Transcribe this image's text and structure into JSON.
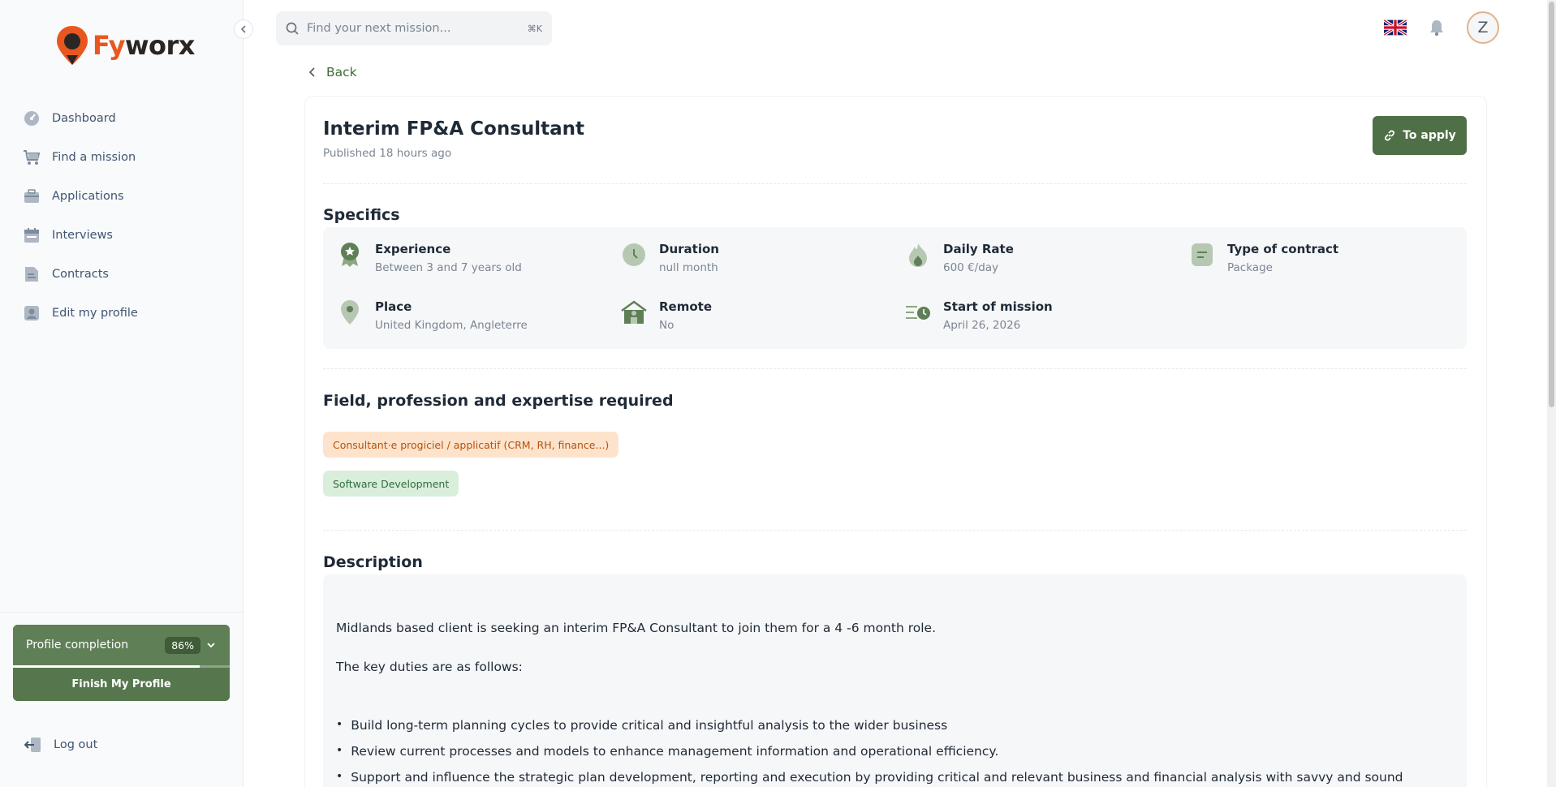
{
  "app": {
    "name_part1": "Fy",
    "name_part2": "worx"
  },
  "sidebar": {
    "items": [
      {
        "label": "Dashboard",
        "icon": "gauge-icon"
      },
      {
        "label": "Find a mission",
        "icon": "cart-icon"
      },
      {
        "label": "Applications",
        "icon": "briefcase-icon"
      },
      {
        "label": "Interviews",
        "icon": "calendar-icon"
      },
      {
        "label": "Contracts",
        "icon": "document-icon"
      },
      {
        "label": "Edit my profile",
        "icon": "user-icon"
      }
    ],
    "profile_completion": {
      "label": "Profile completion",
      "percent_text": "86%",
      "percent": 86,
      "button": "Finish My Profile"
    },
    "logout": "Log out"
  },
  "topbar": {
    "search_placeholder": "Find your next mission...",
    "shortcut": "⌘K",
    "avatar_initial": "Z"
  },
  "mission": {
    "back": "Back",
    "title": "Interim FP&A Consultant",
    "published": "Published 18 hours ago",
    "apply_label": "To apply",
    "specifics_title": "Specifics",
    "specifics": {
      "experience": {
        "label": "Experience",
        "value": "Between 3 and 7 years old"
      },
      "duration": {
        "label": "Duration",
        "value": "null month"
      },
      "daily_rate": {
        "label": "Daily Rate",
        "value": "600 €/day"
      },
      "contract": {
        "label": "Type of contract",
        "value": "Package"
      },
      "place": {
        "label": "Place",
        "value": "United Kingdom, Angleterre"
      },
      "remote": {
        "label": "Remote",
        "value": "No"
      },
      "start": {
        "label": "Start of mission",
        "value": "April 26, 2026"
      }
    },
    "field_title": "Field, profession and expertise required",
    "tags": [
      "Consultant·e progiciel / applicatif (CRM, RH, finance...)",
      "Software Development"
    ],
    "description_title": "Description",
    "description": {
      "intro": "Midlands based client is seeking an interim FP&A Consultant to join them for a 4 -6 month role.",
      "duties_intro": "The key duties are as follows:",
      "duties": [
        "Build long-term planning cycles to provide critical and insightful analysis to the wider business",
        "Review current processes and models to enhance management information and operational efficiency.",
        "Support and influence the strategic plan development, reporting and execution by providing critical and relevant business and financial analysis with savvy and sound"
      ]
    }
  },
  "colors": {
    "brand_orange": "#e8571f",
    "primary_green": "#4f6f47",
    "icon_green": "#8aa882"
  }
}
